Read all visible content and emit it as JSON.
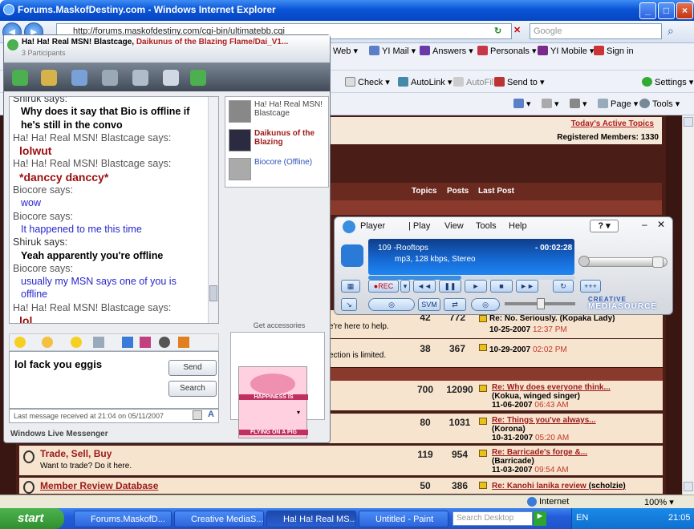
{
  "ie": {
    "title": "Forums.MaskofDestiny.com - Windows Internet Explorer",
    "address": "http://forums.maskofdestiny.com/cgi-bin/ultimatebb.cgi",
    "search_placeholder": "Google",
    "toolbar1": {
      "web": "Web",
      "mail": "YI Mail",
      "answers": "Answers",
      "personals": "Personals",
      "mobile": "YI Mobile",
      "signin": "Sign in"
    },
    "toolbar2": {
      "check": "Check",
      "autolink": "AutoLink",
      "autofill": "AutoFill",
      "sendto": "Send to",
      "settings": "Settings"
    },
    "toolbar3": {
      "page": "Page",
      "tools": "Tools"
    },
    "status_zone": "Internet",
    "zoom": "100%"
  },
  "forum": {
    "active_topics": "Today's Active Topics",
    "registered": "Registered Members: 1330",
    "col_topics": "Topics",
    "col_posts": "Posts",
    "col_lastpost": "Last Post",
    "frag1": "e're here to help.",
    "frag2": "ection is limited.",
    "rows": [
      {
        "topics": "42",
        "posts": "772",
        "lp_title": "",
        "lp_user": "",
        "lp_date": "10-25-2007",
        "lp_time": "12:37 PM",
        "lp_extra": "Re: No. Seriously. (Kopaka Lady)"
      },
      {
        "topics": "38",
        "posts": "367",
        "lp_title": "",
        "lp_user": "",
        "lp_date": "10-29-2007",
        "lp_time": "02:02 PM",
        "lp_extra": ""
      },
      {
        "topics": "700",
        "posts": "12090",
        "lp_title": "Re: Why does everyone think...",
        "lp_user": "(Kokua, winged singer)",
        "lp_date": "11-06-2007",
        "lp_time": "06:43 AM"
      },
      {
        "topics": "80",
        "posts": "1031",
        "lp_title": "Re: Things you've always...",
        "lp_user": "(Korona)",
        "lp_date": "10-31-2007",
        "lp_time": "05:20 AM"
      },
      {
        "topics": "119",
        "posts": "954",
        "lp_title": "Re: Barricade's forge &...",
        "lp_user": "(Barricade)",
        "lp_date": "11-03-2007",
        "lp_time": "09:54 AM",
        "name": "Trade, Sell, Buy",
        "desc": "Want to trade? Do it here."
      },
      {
        "topics": "50",
        "posts": "386",
        "lp_title": "Re: Kanohi lanika review",
        "lp_user": "(scholzie)",
        "name": "Member Review Database"
      }
    ]
  },
  "messenger": {
    "title_prefix": "Ha! Ha! Real MSN! Blastcage, ",
    "title_suffix": "Daikunus of the Blazing Flame/Dai_V1...",
    "participants": "3 Participants",
    "conversation": [
      {
        "who": "Shiruk says:",
        "kind": "shiruk-head"
      },
      {
        "text": "Why does it say that Bio is offline if",
        "kind": "shiruk"
      },
      {
        "text": "he's still in the convo",
        "kind": "shiruk"
      },
      {
        "who": "Ha! Ha! Real MSN! Blastcage says:",
        "kind": "who"
      },
      {
        "text": "lolwut",
        "kind": "blast"
      },
      {
        "who": "Ha! Ha! Real MSN! Blastcage says:",
        "kind": "who"
      },
      {
        "text": "*danccy danccy*",
        "kind": "blast"
      },
      {
        "who": "Biocore says:",
        "kind": "who"
      },
      {
        "text": "wow",
        "kind": "bio"
      },
      {
        "who": "Biocore says:",
        "kind": "who"
      },
      {
        "text": "It happened to me this time",
        "kind": "bio"
      },
      {
        "who": "Shiruk says:",
        "kind": "shiruk-head"
      },
      {
        "text": "Yeah apparently you're offline",
        "kind": "shiruk"
      },
      {
        "who": "Biocore says:",
        "kind": "who"
      },
      {
        "text": "usually my MSN says one of you is",
        "kind": "bio"
      },
      {
        "text": "offline",
        "kind": "bio"
      },
      {
        "who": "Ha! Ha! Real MSN! Blastcage says:",
        "kind": "who"
      },
      {
        "text": "lol.",
        "kind": "blast"
      }
    ],
    "contacts": [
      {
        "name": "Ha! Ha! Real MSN! Blastcage"
      },
      {
        "name": "Daikunus of the Blazing"
      },
      {
        "name": "Biocore (Offline)"
      }
    ],
    "ad_label": "Get accessories",
    "ad_caption_top": "HAPPINESS IS",
    "ad_caption_bottom": "FLYING ON A PIG",
    "input_text": "lol fack you eggis",
    "send": "Send",
    "search": "Search",
    "last_message": "Last message received at 21:04 on 05/11/2007",
    "footer": "Windows Live Messenger"
  },
  "player": {
    "menu": [
      "Player",
      "Play",
      "View",
      "Tools",
      "Help"
    ],
    "track": "109 -Rooftops",
    "time": "- 00:02:28",
    "info": "mp3, 128 kbps, Stereo",
    "rec": "REC",
    "brand": "CREATIVE",
    "brand2": "MEDIASOURCE",
    "btn_svm": "SVM",
    "btn_fx": "+++",
    "help": "?"
  },
  "taskbar": {
    "start": "start",
    "tasks": [
      "Forums.MaskofD...",
      "Creative MediaS...",
      "Ha! Ha! Real MS...",
      "Untitled - Paint"
    ],
    "search": "Search Desktop",
    "lang": "EN",
    "clock": "21:05"
  }
}
